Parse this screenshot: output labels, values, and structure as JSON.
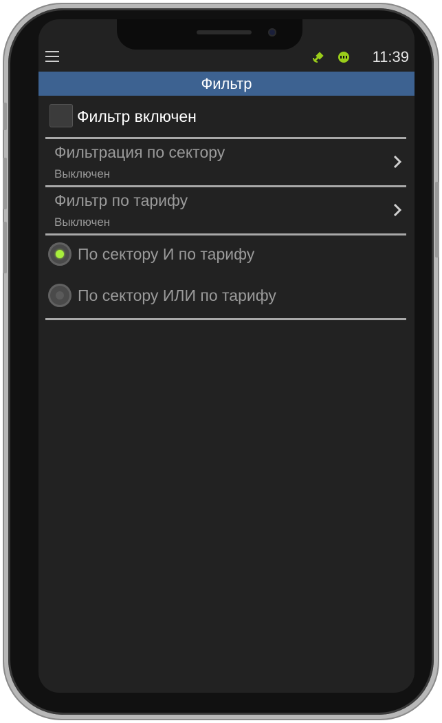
{
  "status_bar": {
    "time": "11:39",
    "icons": [
      "menu-icon",
      "satellite-icon",
      "taxi-icon"
    ]
  },
  "header": {
    "title": "Фильтр",
    "background_color": "#3d6291"
  },
  "filter_toggle": {
    "label": "Фильтр включен",
    "checked": false
  },
  "sections": [
    {
      "title": "Фильтрация по сектору",
      "value": "Выключен"
    },
    {
      "title": "Фильтр по тарифу",
      "value": "Выключен"
    }
  ],
  "modes": [
    {
      "label": "По сектору И по тарифу",
      "selected": true
    },
    {
      "label": "По сектору ИЛИ по тарифу",
      "selected": false
    }
  ],
  "colors": {
    "accent_green": "#a8ef3c",
    "background": "#222222"
  }
}
